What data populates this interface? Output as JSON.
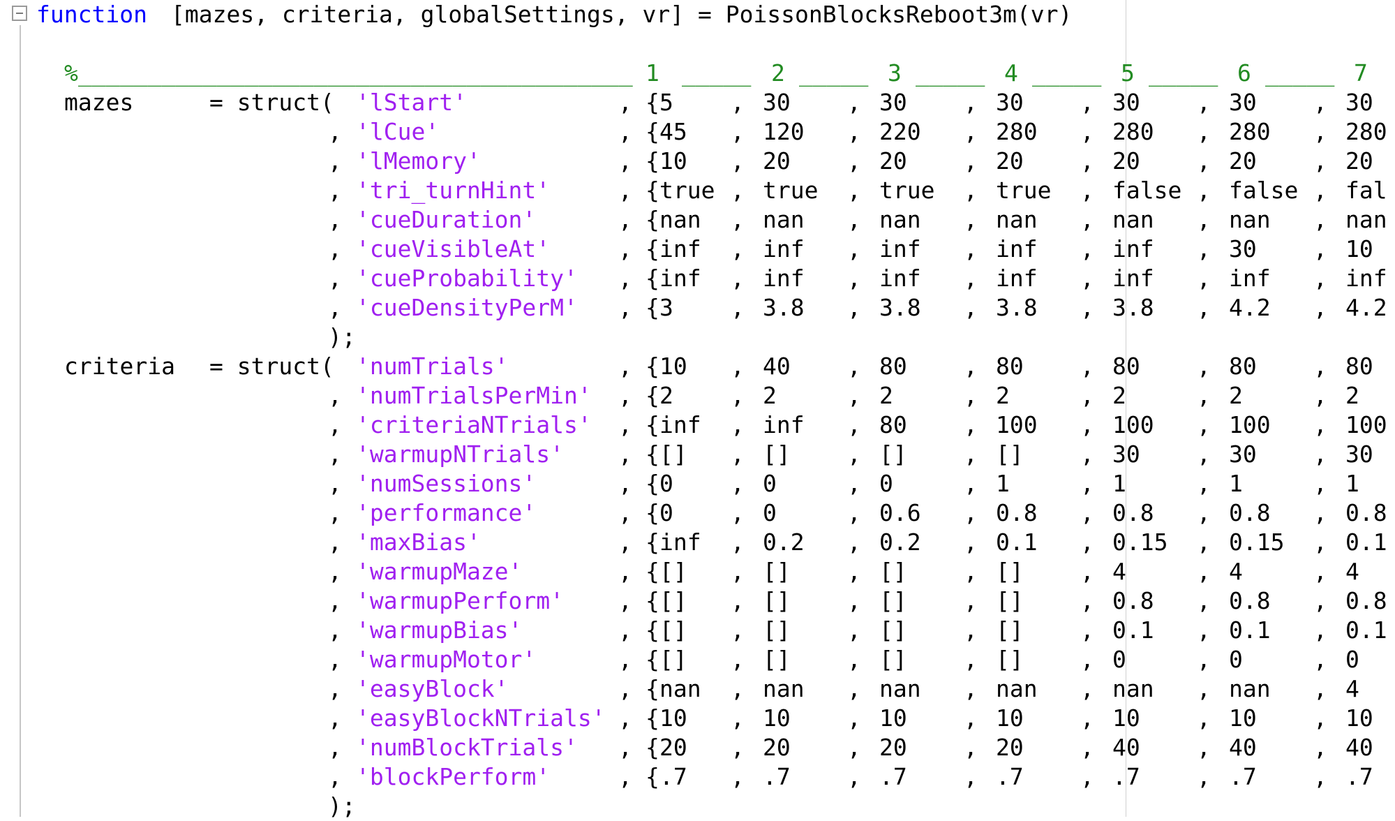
{
  "code": {
    "header": {
      "keyword": "function",
      "signature": "[mazes, criteria, globalSettings, vr] = PoissonBlocksReboot3m(vr)"
    },
    "comment_header": {
      "lead": "%",
      "columns": [
        "1",
        "2",
        "3",
        "4",
        "5",
        "6",
        "7"
      ]
    },
    "structs": [
      {
        "name": "mazes",
        "fields": [
          {
            "key": "'lStart'",
            "values": [
              "5",
              "30",
              "30",
              "30",
              "30",
              "30",
              "30"
            ]
          },
          {
            "key": "'lCue'",
            "values": [
              "45",
              "120",
              "220",
              "280",
              "280",
              "280",
              "280"
            ]
          },
          {
            "key": "'lMemory'",
            "values": [
              "10",
              "20",
              "20",
              "20",
              "20",
              "20",
              "20"
            ]
          },
          {
            "key": "'tri_turnHint'",
            "values": [
              "true",
              "true",
              "true",
              "true",
              "false",
              "false",
              "fal"
            ]
          },
          {
            "key": "'cueDuration'",
            "values": [
              "nan",
              "nan",
              "nan",
              "nan",
              "nan",
              "nan",
              "nan"
            ]
          },
          {
            "key": "'cueVisibleAt'",
            "values": [
              "inf",
              "inf",
              "inf",
              "inf",
              "inf",
              "30",
              "10"
            ]
          },
          {
            "key": "'cueProbability'",
            "values": [
              "inf",
              "inf",
              "inf",
              "inf",
              "inf",
              "inf",
              "inf"
            ]
          },
          {
            "key": "'cueDensityPerM'",
            "values": [
              "3",
              "3.8",
              "3.8",
              "3.8",
              "3.8",
              "4.2",
              "4.2"
            ]
          }
        ]
      },
      {
        "name": "criteria",
        "fields": [
          {
            "key": "'numTrials'",
            "values": [
              "10",
              "40",
              "80",
              "80",
              "80",
              "80",
              "80"
            ]
          },
          {
            "key": "'numTrialsPerMin'",
            "values": [
              "2",
              "2",
              "2",
              "2",
              "2",
              "2",
              "2"
            ]
          },
          {
            "key": "'criteriaNTrials'",
            "values": [
              "inf",
              "inf",
              "80",
              "100",
              "100",
              "100",
              "100"
            ]
          },
          {
            "key": "'warmupNTrials'",
            "values": [
              "[]",
              "[]",
              "[]",
              "[]",
              "30",
              "30",
              "30"
            ]
          },
          {
            "key": "'numSessions'",
            "values": [
              "0",
              "0",
              "0",
              "1",
              "1",
              "1",
              "1"
            ]
          },
          {
            "key": "'performance'",
            "values": [
              "0",
              "0",
              "0.6",
              "0.8",
              "0.8",
              "0.8",
              "0.8"
            ]
          },
          {
            "key": "'maxBias'",
            "values": [
              "inf",
              "0.2",
              "0.2",
              "0.1",
              "0.15",
              "0.15",
              "0.1"
            ]
          },
          {
            "key": "'warmupMaze'",
            "values": [
              "[]",
              "[]",
              "[]",
              "[]",
              "4",
              "4",
              "4"
            ]
          },
          {
            "key": "'warmupPerform'",
            "values": [
              "[]",
              "[]",
              "[]",
              "[]",
              "0.8",
              "0.8",
              "0.8"
            ]
          },
          {
            "key": "'warmupBias'",
            "values": [
              "[]",
              "[]",
              "[]",
              "[]",
              "0.1",
              "0.1",
              "0.1"
            ]
          },
          {
            "key": "'warmupMotor'",
            "values": [
              "[]",
              "[]",
              "[]",
              "[]",
              "0",
              "0",
              "0"
            ]
          },
          {
            "key": "'easyBlock'",
            "values": [
              "nan",
              "nan",
              "nan",
              "nan",
              "nan",
              "nan",
              "4"
            ]
          },
          {
            "key": "'easyBlockNTrials'",
            "values": [
              "10",
              "10",
              "10",
              "10",
              "10",
              "10",
              "10"
            ]
          },
          {
            "key": "'numBlockTrials'",
            "values": [
              "20",
              "20",
              "20",
              "20",
              "40",
              "40",
              "40"
            ]
          },
          {
            "key": "'blockPerform'",
            "values": [
              ".7",
              ".7",
              ".7",
              ".7",
              ".7",
              ".7",
              ".7"
            ]
          }
        ]
      }
    ],
    "tokens": {
      "assign": "= struct(",
      "comma": ",",
      "brace": "{",
      "close": ");"
    }
  }
}
